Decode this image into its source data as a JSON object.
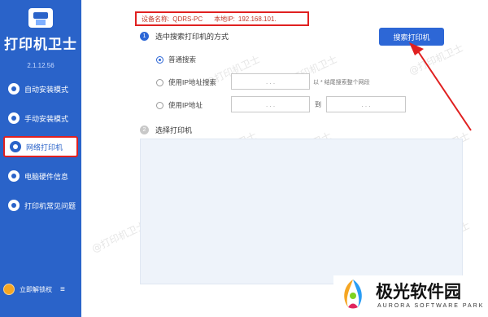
{
  "app": {
    "title": "打印机卫士",
    "version": "2.1.12.56"
  },
  "sidebar": {
    "items": [
      {
        "label": "自动安装模式",
        "icon": "auto-install-icon"
      },
      {
        "label": "手动安装模式",
        "icon": "manual-install-icon"
      },
      {
        "label": "网络打印机",
        "icon": "network-printer-icon",
        "active": true
      },
      {
        "label": "电脑硬件信息",
        "icon": "hardware-info-icon"
      },
      {
        "label": "打印机常见问题",
        "icon": "printer-faq-icon"
      }
    ],
    "unlock_label": "立即解锁权",
    "menu_icon": "hamburger-icon"
  },
  "device": {
    "name_label": "设备名称:",
    "name_value": "QDRS-PC",
    "ip_label": "本地IP:",
    "ip_value": "192.168.101."
  },
  "search_button": "搜索打印机",
  "step1": {
    "num": "1",
    "title": "选中搜索打印机的方式",
    "options": [
      {
        "label": "普通搜索",
        "checked": true
      },
      {
        "label": "使用IP地址搜索",
        "checked": false
      },
      {
        "label": "使用IP地址",
        "checked": false
      }
    ],
    "ip_dots": ".     .     .",
    "hint": "以 * 结尾搜索整个网段",
    "to_label": "到"
  },
  "step2": {
    "num": "2",
    "title": "选择打印机"
  },
  "watermark_text": "@打印机卫士",
  "brand": {
    "name": "极光软件园",
    "sub": "AURORA SOFTWARE PARK"
  },
  "colors": {
    "sidebar": "#2a63c9",
    "accent": "#2d67d6",
    "highlight": "#e02020"
  }
}
